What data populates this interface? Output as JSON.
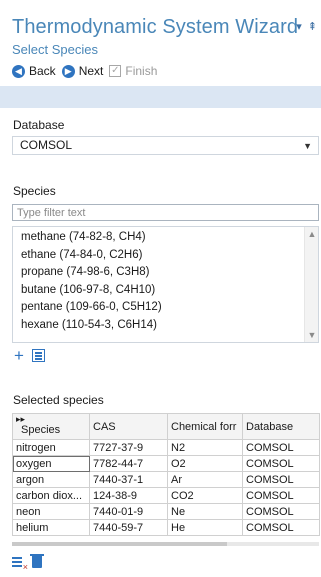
{
  "header": {
    "title": "Thermodynamic System Wizard",
    "subtitle": "Select Species",
    "controls": {
      "menu": "▾",
      "pin": "⇞"
    },
    "nav": {
      "back": "Back",
      "next": "Next",
      "finish": "Finish"
    }
  },
  "database": {
    "label": "Database",
    "value": "COMSOL"
  },
  "species": {
    "label": "Species",
    "filter_placeholder": "Type filter text",
    "items": [
      "methane (74-82-8, CH4)",
      "ethane (74-84-0, C2H6)",
      "propane (74-98-6, C3H8)",
      "butane (106-97-8, C4H10)",
      "pentane (109-66-0, C5H12)",
      "hexane (110-54-3, C6H14)"
    ]
  },
  "selected": {
    "label": "Selected species",
    "columns": [
      "Species",
      "CAS",
      "Chemical forr",
      "Database"
    ],
    "rows": [
      [
        "nitrogen",
        "7727-37-9",
        "N2",
        "COMSOL"
      ],
      [
        "oxygen",
        "7782-44-7",
        "O2",
        "COMSOL"
      ],
      [
        "argon",
        "7440-37-1",
        "Ar",
        "COMSOL"
      ],
      [
        "carbon diox...",
        "124-38-9",
        "CO2",
        "COMSOL"
      ],
      [
        "neon",
        "7440-01-9",
        "Ne",
        "COMSOL"
      ],
      [
        "helium",
        "7440-59-7",
        "He",
        "COMSOL"
      ]
    ]
  },
  "colors": {
    "accent": "#2f74c0",
    "title": "#4a87b8",
    "band": "#dbe6f3"
  }
}
